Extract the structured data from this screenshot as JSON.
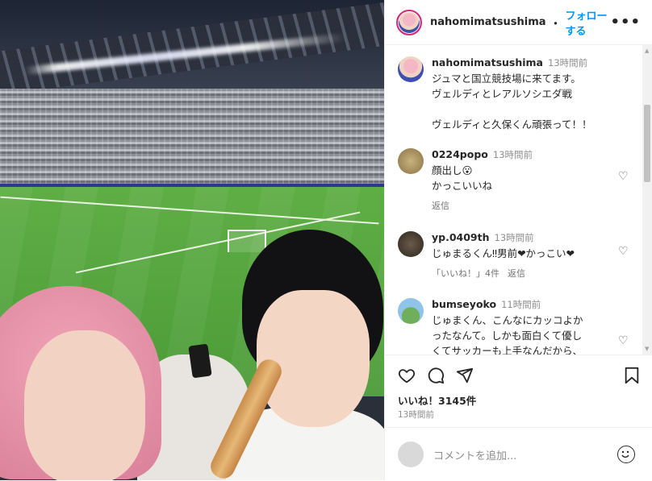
{
  "header": {
    "username": "nahomimatsushima",
    "separator": "・",
    "follow_label": "フォローする",
    "more_icon": "more-icon"
  },
  "caption": {
    "username": "nahomimatsushima",
    "time": "13時間前",
    "line1": "ジュマと国立競技場に来てます。",
    "line2": "ヴェルディとレアルソシエダ戦",
    "line3": "ヴェルディと久保くん頑張って！！"
  },
  "comments": [
    {
      "username": "0224popo",
      "time": "13時間前",
      "text1": "顔出し😮",
      "text2": "かっこいいね",
      "reply": "返信"
    },
    {
      "username": "yp.0409th",
      "time": "13時間前",
      "text1": "じゅまるくん‼︎男前❤かっこい❤",
      "likes": "「いいね！」4件",
      "reply": "返信"
    },
    {
      "username": "bumseyoko",
      "time": "11時間前",
      "text1": "じゅまくん、こんなにカッコよか",
      "text2": "ったなんて。しかも面白くて優し",
      "text3": "くてサッカーも上手なんだから、"
    }
  ],
  "actions": {
    "likes": "いいね！3145件",
    "time": "13時間前"
  },
  "add_comment": {
    "placeholder": "コメントを追加..."
  },
  "colors": {
    "accent": "#0095f6",
    "text": "#262626",
    "muted": "#8e8e8e"
  }
}
